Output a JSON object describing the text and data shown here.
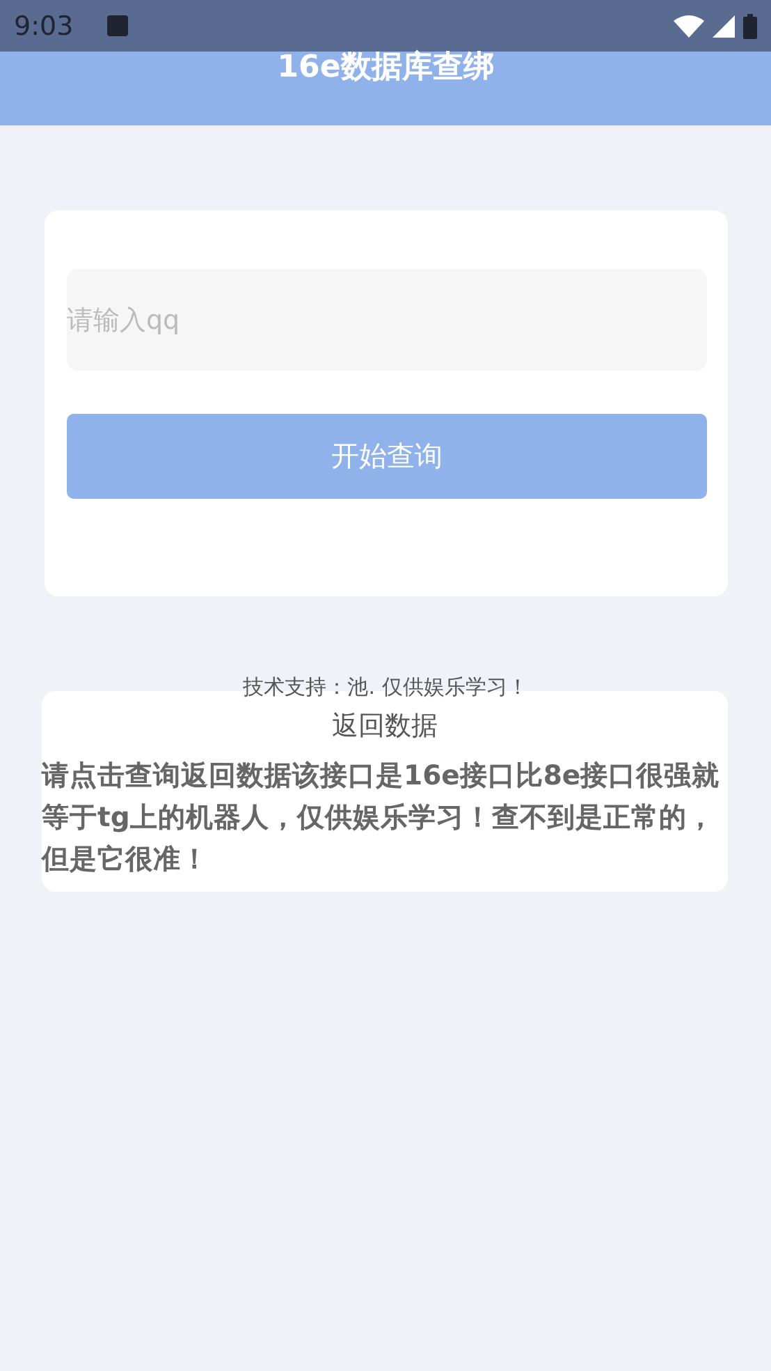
{
  "status_bar": {
    "time": "9:03"
  },
  "header": {
    "title": "16e数据库查绑"
  },
  "query_card": {
    "input": {
      "placeholder": "请输入qq"
    },
    "button": "开始查询"
  },
  "credit": "技术支持：池. 仅供娱乐学习！",
  "result_card": {
    "title": "返回数据",
    "body": "请点击查询返回数据该接口是16e接口比8e接口很强就等于tg上的机器人，仅供娱乐学习！查不到是正常的，但是它很准！"
  }
}
